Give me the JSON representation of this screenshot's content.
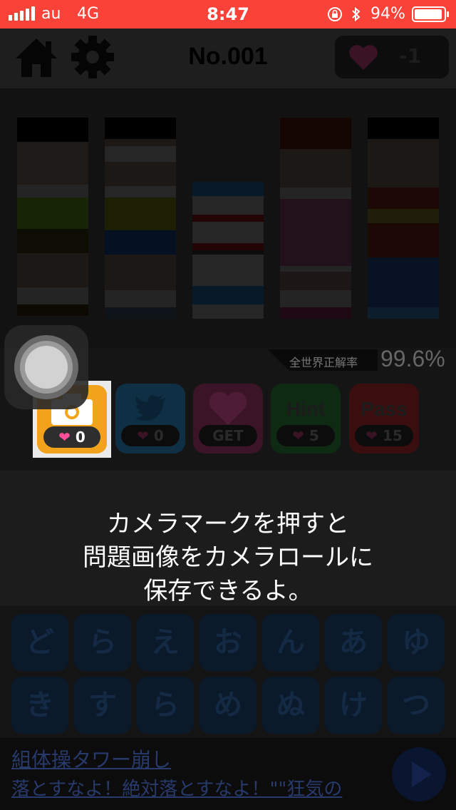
{
  "status_bar": {
    "carrier": "au",
    "network": "4G",
    "time": "8:47",
    "battery_percent": "94%",
    "icons": [
      "signal-icon",
      "rotation-lock-icon",
      "bluetooth-icon",
      "battery-icon"
    ]
  },
  "header": {
    "home_icon": "home-icon",
    "settings_icon": "gear-icon",
    "title": "No.001",
    "hearts_value": "-1"
  },
  "stats": {
    "rate_label": "全世界正解率",
    "rate_value": "99.6%"
  },
  "action_buttons": [
    {
      "name": "camera",
      "icon": "camera-icon",
      "label": "",
      "count": "0",
      "color": "#f3a21b"
    },
    {
      "name": "twitter",
      "icon": "twitter-bird-icon",
      "label": "",
      "count": "0",
      "color": "#0e2f44"
    },
    {
      "name": "heart-get",
      "icon": "heart-icon",
      "label": "",
      "count": "GET",
      "color": "#3c1428"
    },
    {
      "name": "hint",
      "icon": "",
      "label": "Hint",
      "count": "5",
      "color": "#0f2a12"
    },
    {
      "name": "pass",
      "icon": "",
      "label": "Pass",
      "count": "15",
      "color": "#3a0e0e"
    }
  ],
  "tutorial_text": "カメラマークを押すと\n問題画像をカメラロールに\n保存できるよ。\nLINEやメールで友達に\n聞くときに使ってね!",
  "keyboard": {
    "row1": [
      "ど",
      "ら",
      "え",
      "お",
      "ん",
      "あ",
      "ゆ"
    ],
    "row2": [
      "き",
      "す",
      "ら",
      "め",
      "ぬ",
      "け",
      "つ"
    ]
  },
  "ad": {
    "title": "組体操タワー崩し",
    "description": "落とすなよ！絶対落とすなよ！\"\"狂気の"
  },
  "colors": {
    "status_bar": "#fa4238",
    "camera_button": "#f3a21b",
    "heart": "#ff4f9a"
  }
}
